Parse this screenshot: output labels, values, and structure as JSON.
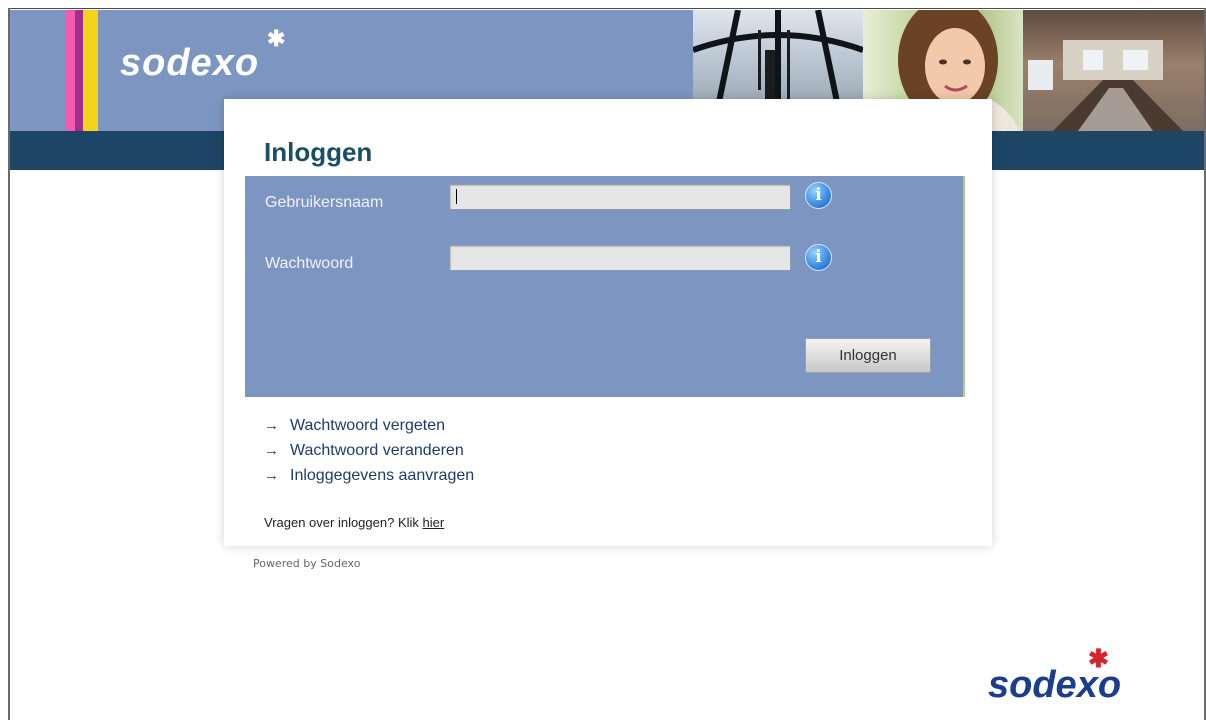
{
  "banner": {
    "logo_text": "sodexo",
    "logo_star": "✱",
    "stripe_colors": [
      "#f25bb0",
      "#9f2e8e",
      "#f2d51b"
    ]
  },
  "login": {
    "title": "Inloggen",
    "username_label": "Gebruikersnaam",
    "username_value": "",
    "password_label": "Wachtwoord",
    "password_value": "",
    "info_icon_label": "i",
    "submit_label": "Inloggen"
  },
  "links": {
    "arrow": "→",
    "items": [
      "Wachtwoord vergeten",
      "Wachtwoord veranderen",
      "Inloggegevens aanvragen"
    ]
  },
  "help": {
    "prefix": "Vragen over inloggen? Klik ",
    "link": "hier"
  },
  "footer": {
    "powered": "Powered by Sodexo",
    "logo_text": "sodexo",
    "logo_star": "✱"
  },
  "colors": {
    "banner_blue": "#7d96c1",
    "band_navy": "#1c4566",
    "title_teal": "#1a4d66",
    "link_blue": "#1e3d6b",
    "logo_blue": "#1a3e8c",
    "logo_star_red": "#d5232f"
  },
  "icons": {
    "info": "info-icon",
    "arrow": "arrow-right-icon",
    "logo_star": "star-icon"
  }
}
